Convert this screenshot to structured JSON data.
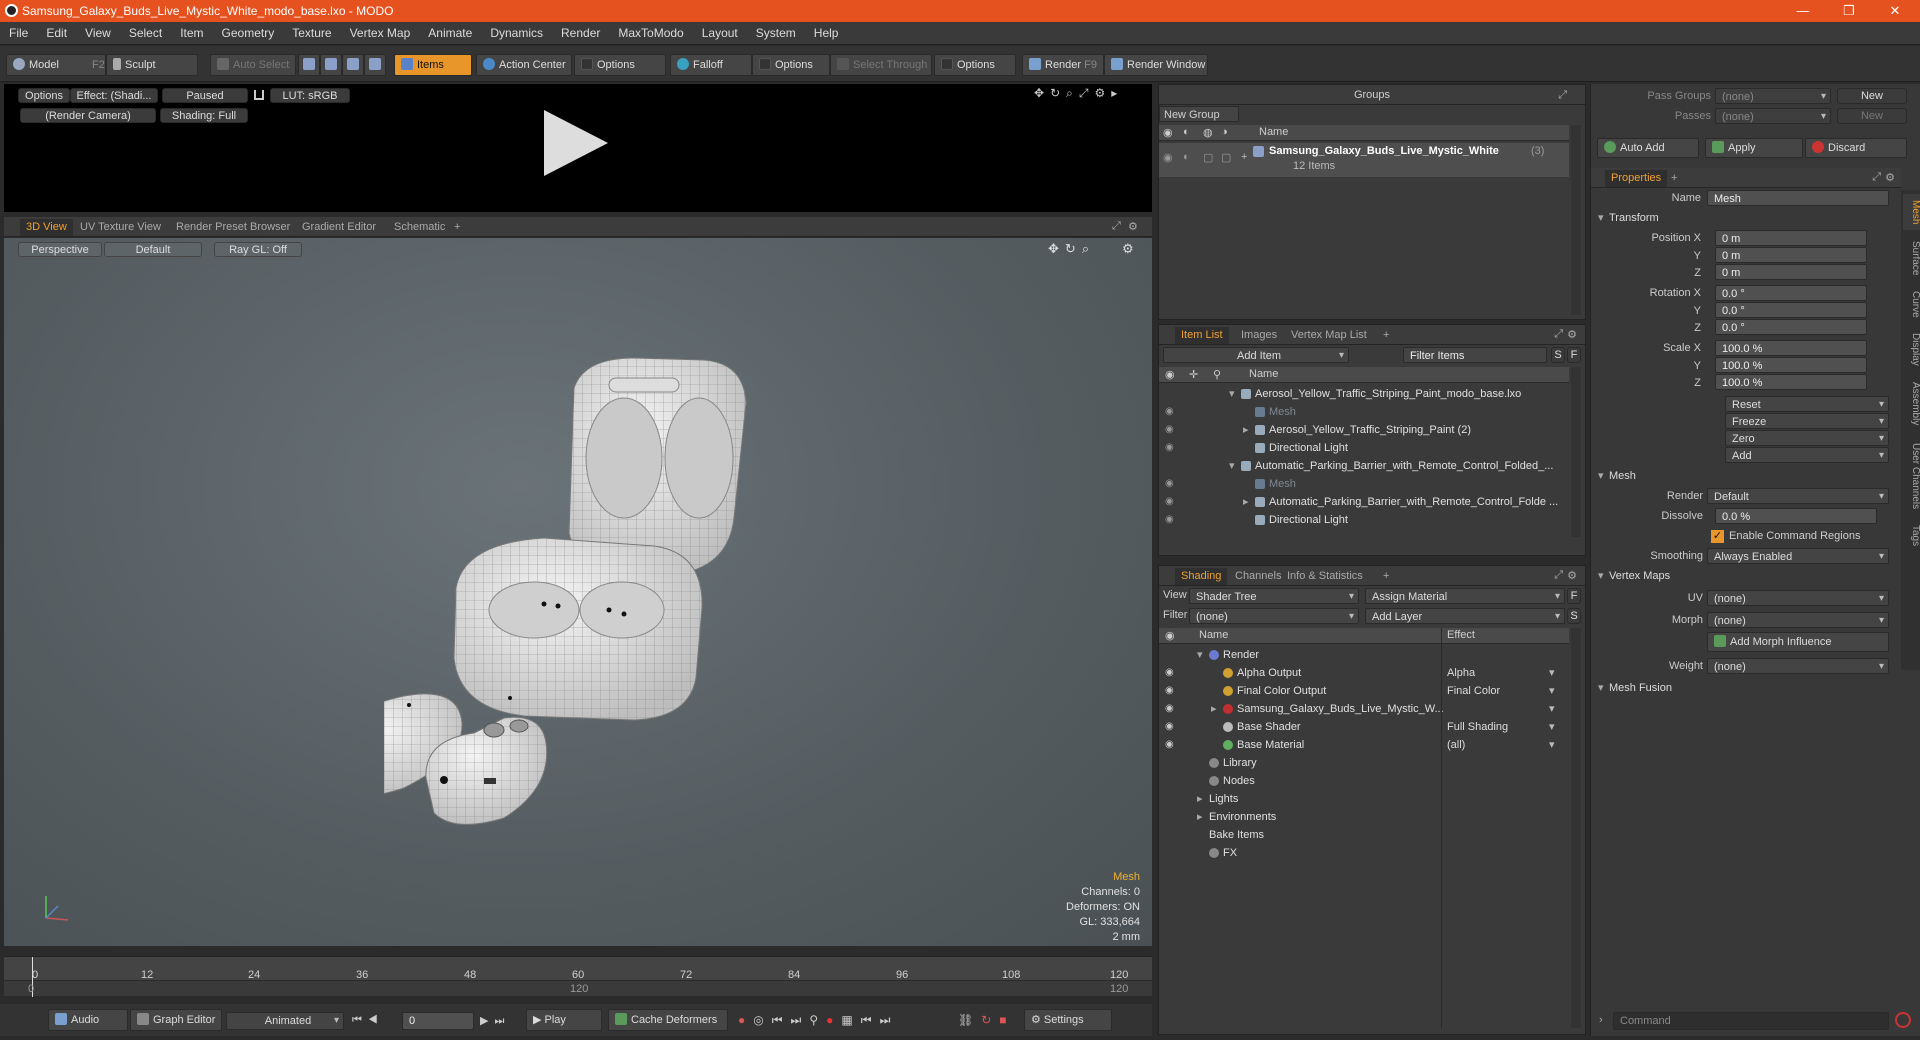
{
  "app": {
    "title": "Samsung_Galaxy_Buds_Live_Mystic_White_modo_base.lxo - MODO"
  },
  "menu": [
    "File",
    "Edit",
    "View",
    "Select",
    "Item",
    "Geometry",
    "Texture",
    "Vertex Map",
    "Animate",
    "Dynamics",
    "Render",
    "MaxToModo",
    "Layout",
    "System",
    "Help"
  ],
  "toolbar": {
    "model": "Model",
    "model_key": "F2",
    "sculpt": "Sculpt",
    "auto_select": "Auto Select",
    "items": "Items",
    "action_center": "Action Center",
    "options1": "Options",
    "falloff": "Falloff",
    "options2": "Options",
    "select_through": "Select Through",
    "options3": "Options",
    "render": "Render",
    "render_key": "F9",
    "render_window": "Render Window"
  },
  "preview": {
    "options": "Options",
    "effect": "Effect: (Shadi...",
    "paused": "Paused",
    "lut": "LUT: sRGB",
    "camera": "(Render Camera)",
    "shading": "Shading: Full"
  },
  "viewport_tabs": [
    "3D View",
    "UV Texture View",
    "Render Preset Browser",
    "Gradient Editor",
    "Schematic",
    "+"
  ],
  "viewport": {
    "perspective": "Perspective",
    "default": "Default",
    "raygl": "Ray GL: Off",
    "info_title": "Mesh",
    "channels": "Channels: 0",
    "deformers": "Deformers: ON",
    "gl": "GL: 333,664",
    "size": "2 mm"
  },
  "timeline": {
    "ticks": [
      "0",
      "12",
      "24",
      "36",
      "48",
      "60",
      "72",
      "84",
      "96",
      "108",
      "120"
    ],
    "lower_ticks": [
      "0",
      "120",
      "120"
    ]
  },
  "bottombar": {
    "audio": "Audio",
    "graph_editor": "Graph Editor",
    "animated": "Animated",
    "frame": "0",
    "play": "Play",
    "cache": "Cache Deformers",
    "settings": "Settings"
  },
  "groups": {
    "title": "Groups",
    "new_group": "New Group",
    "col_name": "Name",
    "item_name": "Samsung_Galaxy_Buds_Live_Mystic_White",
    "item_count": "(3)",
    "item_sub": "12 Items"
  },
  "itemlist": {
    "tabs": [
      "Item List",
      "Images",
      "Vertex Map List",
      "+"
    ],
    "add_item": "Add Item",
    "filter": "Filter Items",
    "s": "S",
    "f": "F",
    "col_name": "Name",
    "rows": [
      {
        "indent": 0,
        "text": "Aerosol_Yellow_Traffic_Striping_Paint_modo_base.lxo",
        "dim": false,
        "arrow": "▾"
      },
      {
        "indent": 1,
        "text": "Mesh",
        "dim": true,
        "arrow": ""
      },
      {
        "indent": 1,
        "text": "Aerosol_Yellow_Traffic_Striping_Paint (2)",
        "dim": false,
        "arrow": "▸"
      },
      {
        "indent": 1,
        "text": "Directional Light",
        "dim": false,
        "arrow": ""
      },
      {
        "indent": 0,
        "text": "Automatic_Parking_Barrier_with_Remote_Control_Folded_...",
        "dim": false,
        "arrow": "▾"
      },
      {
        "indent": 1,
        "text": "Mesh",
        "dim": true,
        "arrow": ""
      },
      {
        "indent": 1,
        "text": "Automatic_Parking_Barrier_with_Remote_Control_Folde ...",
        "dim": false,
        "arrow": "▸"
      },
      {
        "indent": 1,
        "text": "Directional Light",
        "dim": false,
        "arrow": ""
      }
    ]
  },
  "shading": {
    "tabs": [
      "Shading",
      "Channels",
      "Info & Statistics",
      "+"
    ],
    "view_label": "View",
    "view_value": "Shader Tree",
    "assign": "Assign Material",
    "filter_label": "Filter",
    "filter_value": "(none)",
    "add_layer": "Add Layer",
    "col_name": "Name",
    "col_effect": "Effect",
    "rows": [
      {
        "indent": 0,
        "text": "Render",
        "effect": "",
        "arrow": "▾",
        "color": "#6a7ad0"
      },
      {
        "indent": 1,
        "text": "Alpha Output",
        "effect": "Alpha",
        "arrow": "",
        "color": "#d0a030"
      },
      {
        "indent": 1,
        "text": "Final Color Output",
        "effect": "Final Color",
        "arrow": "",
        "color": "#d0a030"
      },
      {
        "indent": 1,
        "text": "Samsung_Galaxy_Buds_Live_Mystic_W...",
        "effect": "",
        "arrow": "▸",
        "color": "#c03030"
      },
      {
        "indent": 1,
        "text": "Base Shader",
        "effect": "Full Shading",
        "arrow": "",
        "color": "#bbbbbb"
      },
      {
        "indent": 1,
        "text": "Base Material",
        "effect": "(all)",
        "arrow": "",
        "color": "#60b060"
      },
      {
        "indent": 0,
        "text": "Library",
        "effect": "",
        "arrow": "",
        "color": "#888888"
      },
      {
        "indent": 0,
        "text": "Nodes",
        "effect": "",
        "arrow": "",
        "color": "#888888"
      },
      {
        "indent": 0,
        "text": "Lights",
        "effect": "",
        "arrow": "▸",
        "color": ""
      },
      {
        "indent": 0,
        "text": "Environments",
        "effect": "",
        "arrow": "▸",
        "color": ""
      },
      {
        "indent": 0,
        "text": "Bake Items",
        "effect": "",
        "arrow": "",
        "color": ""
      },
      {
        "indent": 0,
        "text": "FX",
        "effect": "",
        "arrow": "",
        "color": "#888888"
      }
    ]
  },
  "props": {
    "pass_groups": "Pass Groups",
    "passes": "Passes",
    "none": "(none)",
    "new": "New",
    "auto_add": "Auto Add",
    "apply": "Apply",
    "discard": "Discard",
    "tab": "Properties",
    "name_label": "Name",
    "name_value": "Mesh",
    "transform": "Transform",
    "pos_x": "Position X",
    "y": "Y",
    "z": "Z",
    "rot_x": "Rotation X",
    "scale_x": "Scale X",
    "pos": [
      "0 m",
      "0 m",
      "0 m"
    ],
    "rot": [
      "0.0 °",
      "0.0 °",
      "0.0 °"
    ],
    "scl": [
      "100.0 %",
      "100.0 %",
      "100.0 %"
    ],
    "reset": "Reset",
    "freeze": "Freeze",
    "zero": "Zero",
    "add": "Add",
    "mesh": "Mesh",
    "render_label": "Render",
    "render_value": "Default",
    "dissolve_label": "Dissolve",
    "dissolve_value": "0.0 %",
    "enable_cmd": "Enable Command Regions",
    "smoothing_label": "Smoothing",
    "smoothing_value": "Always Enabled",
    "vertex_maps": "Vertex Maps",
    "uv_label": "UV",
    "morph_label": "Morph",
    "add_morph": "Add Morph Influence",
    "weight_label": "Weight",
    "mesh_fusion": "Mesh Fusion",
    "side_tabs": [
      "Mesh",
      "Surface",
      "Curve",
      "Display",
      "Assembly",
      "User Channels",
      "Tags"
    ],
    "command": "Command"
  }
}
